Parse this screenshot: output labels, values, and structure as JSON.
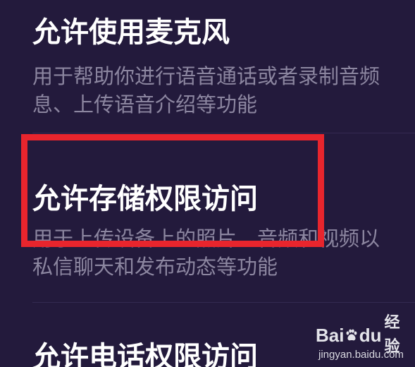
{
  "permissions": [
    {
      "title": "允许使用麦克风",
      "description_line1": "用于帮助你进行语音通话或者录制音频",
      "description_line2": "息、上传语音介绍等功能"
    },
    {
      "title": "允许存储权限访问",
      "description_line1": "用于上传设备上的照片、音频和视频以",
      "description_line2": "私信聊天和发布动态等功能"
    },
    {
      "title": "允许电话权限访问"
    }
  ],
  "watermark": {
    "brand_bai": "Bai",
    "brand_du": "du",
    "brand_jingyan": "经验",
    "url": "jingyan.baidu.com"
  },
  "colors": {
    "background": "#231a3c",
    "title_text": "#ffffff",
    "description_text": "#8c86a0",
    "highlight_border": "#e8252d"
  }
}
